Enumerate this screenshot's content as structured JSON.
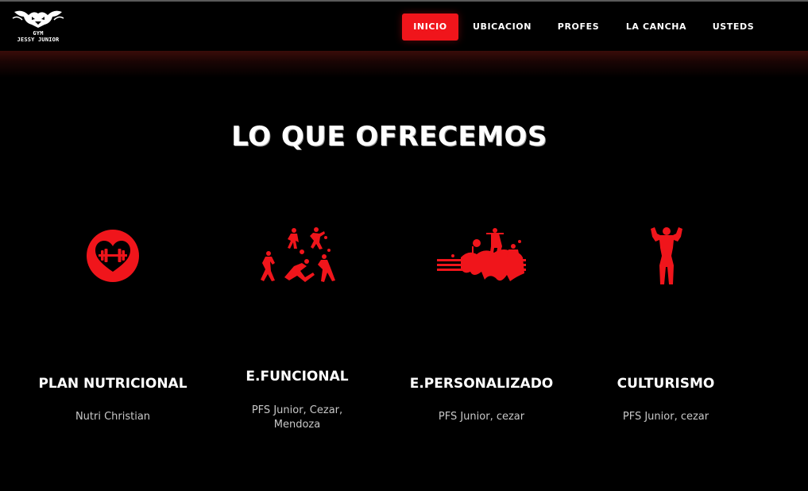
{
  "brand": {
    "line1": "GYM",
    "line2": "JESSY JUNIOR"
  },
  "nav": {
    "items": [
      {
        "label": "INICIO",
        "active": true
      },
      {
        "label": "UBICACION",
        "active": false
      },
      {
        "label": "PROFES",
        "active": false
      },
      {
        "label": "LA CANCHA",
        "active": false
      },
      {
        "label": "USTEDS",
        "active": false
      }
    ]
  },
  "section": {
    "title": "LO QUE OFRECEMOS",
    "cards": [
      {
        "icon": "heart-dumbbell-icon",
        "title": "PLAN NUTRICIONAL",
        "desc": "Nutri Christian"
      },
      {
        "icon": "football-players-icon",
        "title": "E.FUNCIONAL",
        "desc": "PFS Junior, Cezar, Mendoza"
      },
      {
        "icon": "weightlifting-group-icon",
        "title": "E.PERSONALIZADO",
        "desc": "PFS Junior, cezar"
      },
      {
        "icon": "bodybuilder-icon",
        "title": "CULTURISMO",
        "desc": "PFS Junior, cezar"
      }
    ]
  },
  "colors": {
    "accent": "#f0151b",
    "background": "#000000",
    "text": "#ffffff",
    "muted": "#c8c8c8"
  }
}
